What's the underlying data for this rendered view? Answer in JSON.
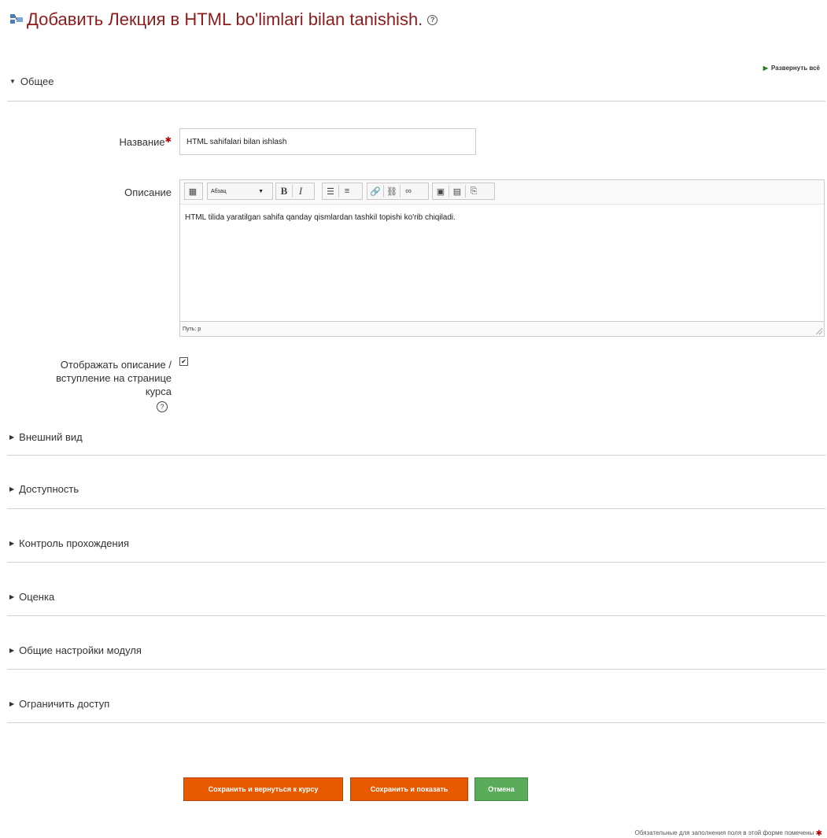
{
  "page": {
    "title": "Добавить Лекция в HTML bo'limlari bilan tanishish.",
    "title_color": "#8c1c1c",
    "expand_all": "Развернуть всё"
  },
  "sections": {
    "general": "Общее",
    "appearance": "Внешний вид",
    "availability": "Доступность",
    "completion": "Контроль прохождения",
    "grade": "Оценка",
    "common_module": "Общие настройки модуля",
    "restrict": "Ограничить доступ"
  },
  "form": {
    "name_label": "Название",
    "name_value": "HTML sahifalari bilan ishlash",
    "description_label": "Описание",
    "format_value": "Абзац",
    "description_text": "HTML tilida yaratilgan sahifa qanday qismlardan tashkil topishi ko'rib chiqiladi.",
    "path_label": "Путь: p",
    "show_description_label_1": "Отображать описание /",
    "show_description_label_2": "вступление на странице",
    "show_description_label_3": "курса",
    "show_description_checked": true
  },
  "buttons": {
    "save_return": "Сохранить и вернуться к курсу",
    "save_display": "Сохранить и показать",
    "cancel": "Отмена"
  },
  "colors": {
    "save_buttons": "#e85a00",
    "cancel_button": "#5aac5a",
    "required_marker": "#bb0000"
  },
  "footer": {
    "required_note": "Обязательные для заполнения поля в этой форме помечены"
  }
}
